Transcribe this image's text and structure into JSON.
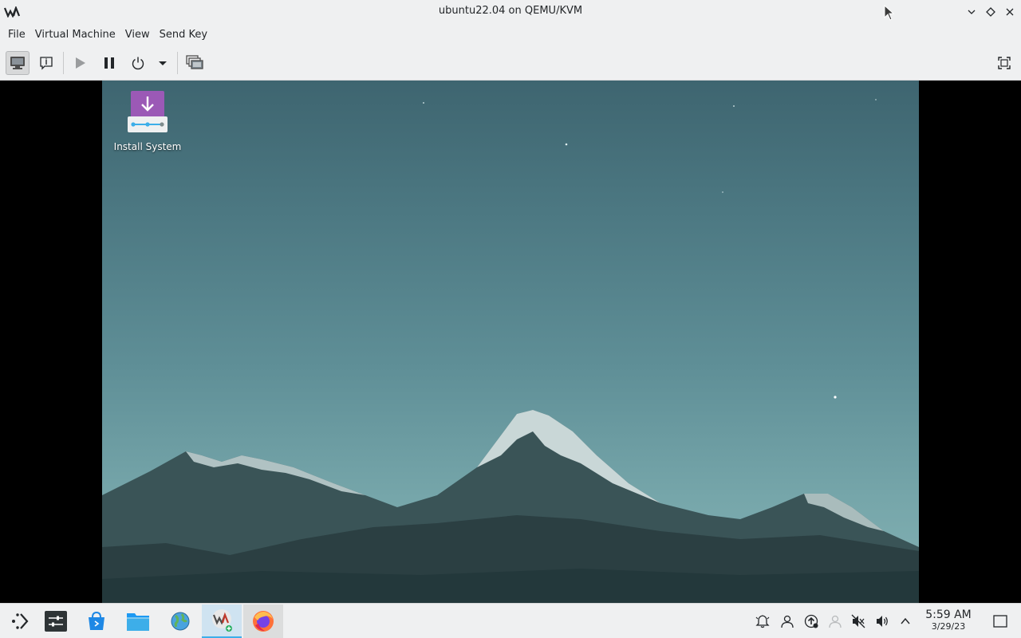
{
  "window": {
    "title": "ubuntu22.04 on QEMU/KVM"
  },
  "menubar": {
    "items": [
      "File",
      "Virtual Machine",
      "View",
      "Send Key"
    ]
  },
  "toolbar": {
    "buttons": [
      {
        "name": "show-graphical-console",
        "icon": "monitor-icon",
        "active": true
      },
      {
        "name": "show-vm-details",
        "icon": "info-icon"
      },
      {
        "name": "run",
        "icon": "play-icon"
      },
      {
        "name": "pause",
        "icon": "pause-icon"
      },
      {
        "name": "shutdown",
        "icon": "power-icon"
      },
      {
        "name": "shutdown-menu",
        "icon": "chevron-down-icon"
      },
      {
        "name": "snapshots",
        "icon": "snapshots-icon"
      },
      {
        "name": "fullscreen",
        "icon": "fullscreen-icon"
      }
    ]
  },
  "guest": {
    "desktop_icons": [
      {
        "label": "Install System",
        "icon": "install-system-icon"
      }
    ]
  },
  "taskbar": {
    "launchers": [
      {
        "name": "application-launcher",
        "icon": "app-launcher-icon"
      },
      {
        "name": "system-settings",
        "icon": "settings-icon"
      },
      {
        "name": "discover",
        "icon": "discover-icon"
      },
      {
        "name": "file-manager",
        "icon": "folder-icon"
      },
      {
        "name": "web-browser",
        "icon": "globe-icon"
      },
      {
        "name": "virt-manager",
        "icon": "virt-manager-icon",
        "active": true
      },
      {
        "name": "firefox",
        "icon": "firefox-icon",
        "open": true
      }
    ],
    "tray": [
      "notifications-icon",
      "user-icon",
      "update-icon",
      "network-icon",
      "mute-icon",
      "volume-icon",
      "expand-tray-icon"
    ],
    "clock": {
      "time": "5:59 AM",
      "date": "3/29/23"
    }
  },
  "colors": {
    "accent": "#3daee9",
    "install_icon": "#9b59b6"
  }
}
